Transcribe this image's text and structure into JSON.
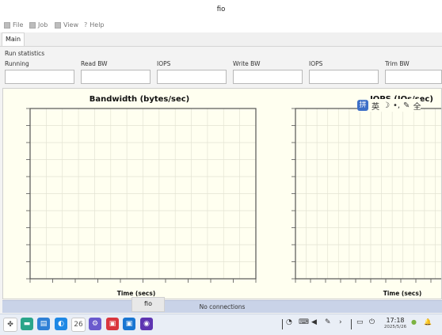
{
  "window": {
    "title": "fio"
  },
  "menu": [
    {
      "label": "File",
      "icon": "file-icon"
    },
    {
      "label": "Job",
      "icon": "job-icon"
    },
    {
      "label": "View",
      "icon": "view-icon"
    },
    {
      "label": "Help",
      "icon": "help-icon",
      "glyph": "?"
    }
  ],
  "tabs": [
    {
      "label": "Main",
      "selected": true
    }
  ],
  "run_stats": {
    "title": "Run statistics",
    "fields": [
      {
        "label": "Running",
        "value": ""
      },
      {
        "label": "Read BW",
        "value": ""
      },
      {
        "label": "IOPS",
        "value": ""
      },
      {
        "label": "Write BW",
        "value": ""
      },
      {
        "label": "IOPS",
        "value": ""
      },
      {
        "label": "Trim BW",
        "value": ""
      }
    ]
  },
  "graphs": [
    {
      "title": "Bandwidth (bytes/sec)",
      "xlabel": "Time (secs)"
    },
    {
      "title": "IOPS (IOs/sec)",
      "xlabel": "Time (secs)"
    }
  ],
  "ime": {
    "pin": "拼",
    "items": [
      "英",
      "☽",
      "•,",
      "✎",
      "全"
    ]
  },
  "status": {
    "connection": "No connections"
  },
  "tooltip": {
    "text": "fio"
  },
  "taskbar": {
    "apps": [
      {
        "name": "launcher-icon",
        "color": "#ffffff",
        "glyph": "✤"
      },
      {
        "name": "terminal-icon",
        "color": "#2aa58a",
        "glyph": "▬"
      },
      {
        "name": "file-manager-icon",
        "color": "#2f80d6",
        "glyph": "▤"
      },
      {
        "name": "browser-icon",
        "color": "#1e88e5",
        "glyph": "◐"
      },
      {
        "name": "calendar-icon",
        "color": "#ffffff",
        "glyph": "26"
      },
      {
        "name": "settings-icon",
        "color": "#6a5acd",
        "glyph": "⚙"
      },
      {
        "name": "app-red-icon",
        "color": "#d9363e",
        "glyph": "▣"
      },
      {
        "name": "app-blue-icon",
        "color": "#1976d2",
        "glyph": "▣"
      },
      {
        "name": "app-purple-icon",
        "color": "#5e35b1",
        "glyph": "◉"
      }
    ],
    "tray": [
      {
        "name": "power-manager-icon",
        "glyph": "◔"
      },
      {
        "name": "keyboard-icon",
        "glyph": "⌨"
      },
      {
        "name": "volume-icon",
        "glyph": "◀"
      },
      {
        "name": "pen-icon",
        "glyph": "✎"
      },
      {
        "name": "expand-icon",
        "glyph": "›"
      },
      {
        "name": "input-method-icon",
        "glyph": "▭"
      },
      {
        "name": "shutdown-icon",
        "glyph": "⏻"
      }
    ],
    "clock": {
      "time": "17:18",
      "date": "2025/5/26"
    },
    "notify": [
      {
        "name": "status-dot-icon",
        "glyph": "●"
      },
      {
        "name": "bell-icon",
        "glyph": "🔔"
      }
    ]
  },
  "colors": {
    "graph_bg": "#fffff0",
    "grid": "#e3e3d3",
    "axis": "#555555",
    "status_bar": "#c9d3e8",
    "taskbar": "#e9eef6",
    "accent": "#3d6fc7"
  }
}
